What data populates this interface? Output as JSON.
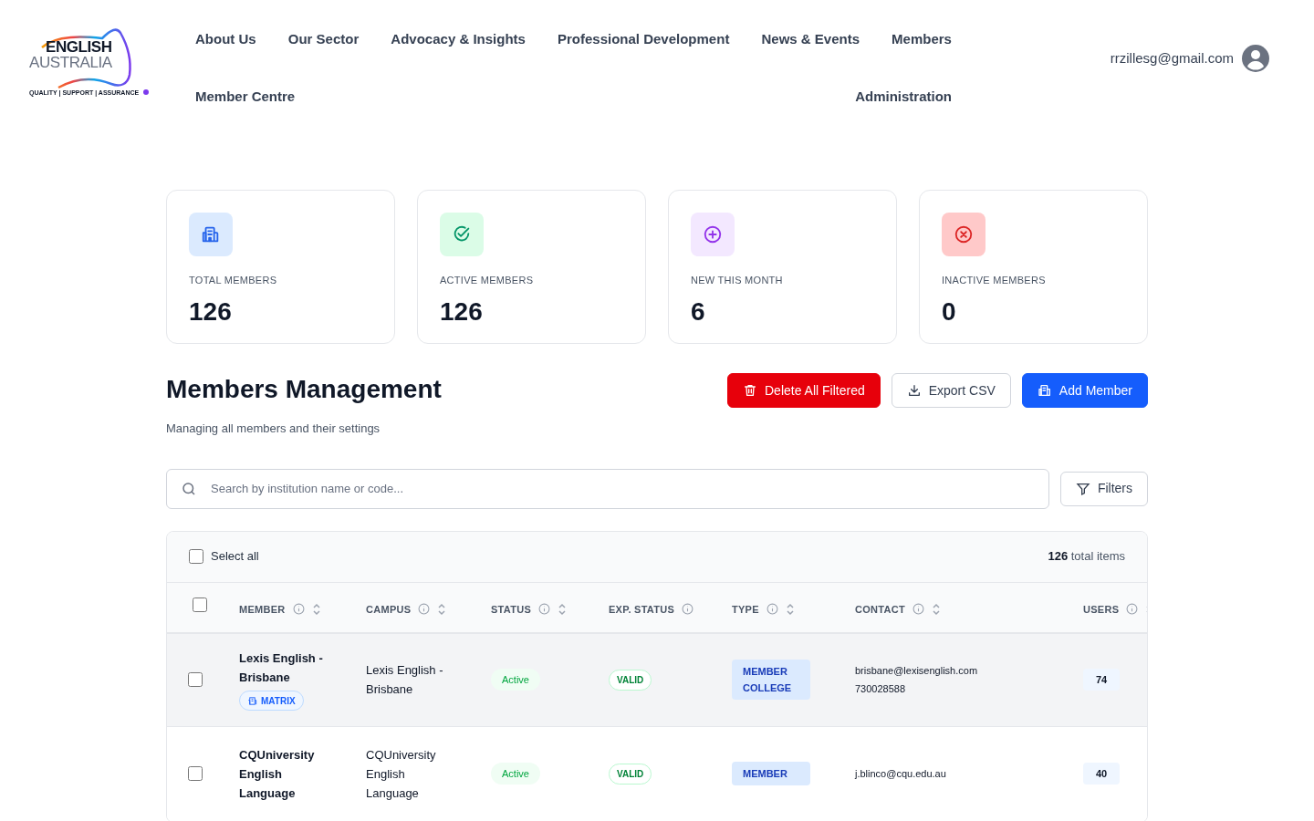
{
  "logo": {
    "line_1": "ENGLISH",
    "line_2": "AUSTRALIA",
    "tagline": "QUALITY | SUPPORT | ASSURANCE"
  },
  "nav": [
    "About Us",
    "Our Sector",
    "Advocacy & Insights",
    "Professional Development",
    "News & Events",
    "Members",
    "Member Centre",
    "Administration"
  ],
  "user": {
    "email": "rrzillesg@gmail.com"
  },
  "stats": [
    {
      "kind": "building",
      "label": "TOTAL MEMBERS",
      "value": "126"
    },
    {
      "kind": "check",
      "label": "ACTIVE MEMBERS",
      "value": "126"
    },
    {
      "kind": "plus",
      "label": "NEW THIS MONTH",
      "value": "6"
    },
    {
      "kind": "x",
      "label": "INACTIVE MEMBERS",
      "value": "0"
    }
  ],
  "title": "Members Management",
  "subtitle": "Managing all members and their settings",
  "actions": [
    {
      "kind": "delete",
      "label": "Delete All Filtered"
    },
    {
      "kind": "export",
      "label": "Export CSV"
    },
    {
      "kind": "add",
      "label": "Add Member"
    }
  ],
  "search": {
    "placeholder": "Search by institution name or code..."
  },
  "filters_button": "Filters",
  "table": {
    "select_all": {
      "label": "Select all",
      "checked": false
    },
    "total_count": "126",
    "total_label": "total items",
    "header_checked": false,
    "columns": [
      {
        "label": "MEMBER",
        "sortable": true
      },
      {
        "label": "CAMPUS",
        "sortable": true
      },
      {
        "label": "STATUS",
        "sortable": true
      },
      {
        "label": "EXP. STATUS",
        "sortable": false
      },
      {
        "label": "TYPE",
        "sortable": true
      },
      {
        "label": "CONTACT",
        "sortable": true
      },
      {
        "label": "USERS",
        "sortable": true
      }
    ],
    "rows": [
      {
        "selected": false,
        "highlighted": true,
        "member": "Lexis English - Brisbane",
        "tag": "MATRIX",
        "campus": "Lexis English - Brisbane",
        "status": "Active",
        "exp_status": "VALID",
        "type": "MEMBER COLLEGE",
        "email": "brisbane@lexisenglish.com",
        "phone": "730028588",
        "users": "74"
      },
      {
        "selected": false,
        "highlighted": false,
        "member": "CQUniversity English Language",
        "campus": "CQUniversity English Language",
        "status": "Active",
        "exp_status": "VALID",
        "type": "MEMBER",
        "email": "j.blinco@cqu.edu.au",
        "users": "40"
      }
    ]
  }
}
